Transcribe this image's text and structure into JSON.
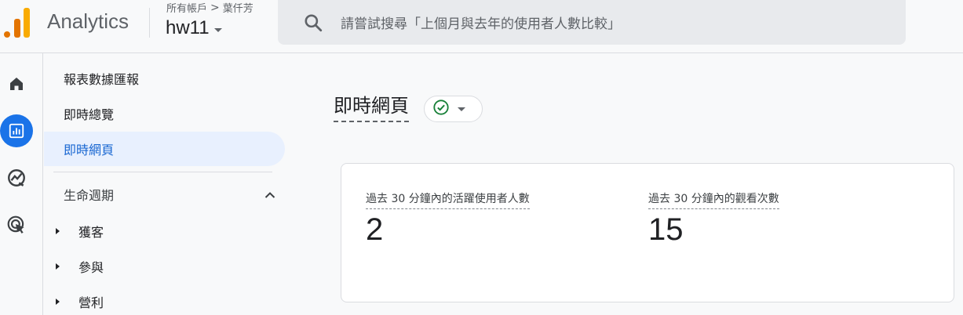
{
  "header": {
    "app_name": "Analytics",
    "breadcrumb": {
      "all_accounts": "所有帳戶",
      "chevron": ">",
      "account": "葉仟芳"
    },
    "property": "hw11",
    "search_placeholder": "請嘗試搜尋「上個月與去年的使用者人數比較」"
  },
  "rail": {
    "items": [
      {
        "icon": "home-icon"
      },
      {
        "icon": "reports-icon",
        "active": true
      },
      {
        "icon": "explore-icon"
      },
      {
        "icon": "advertising-icon"
      }
    ]
  },
  "sidebar": {
    "items": [
      {
        "label": "報表數據匯報"
      },
      {
        "label": "即時總覽"
      },
      {
        "label": "即時網頁",
        "active": true
      }
    ],
    "section": {
      "label": "生命週期",
      "expanded": true
    },
    "sub_items": [
      {
        "label": "獲客"
      },
      {
        "label": "參與"
      },
      {
        "label": "營利"
      }
    ]
  },
  "main": {
    "title": "即時網頁",
    "metrics": [
      {
        "label": "過去 30 分鐘內的活躍使用者人數",
        "value": "2"
      },
      {
        "label": "過去 30 分鐘內的觀看次數",
        "value": "15"
      }
    ]
  },
  "colors": {
    "accent": "#1a73e8",
    "logo_orange": "#e37400",
    "logo_yellow": "#f9ab00",
    "status_green": "#188038"
  }
}
